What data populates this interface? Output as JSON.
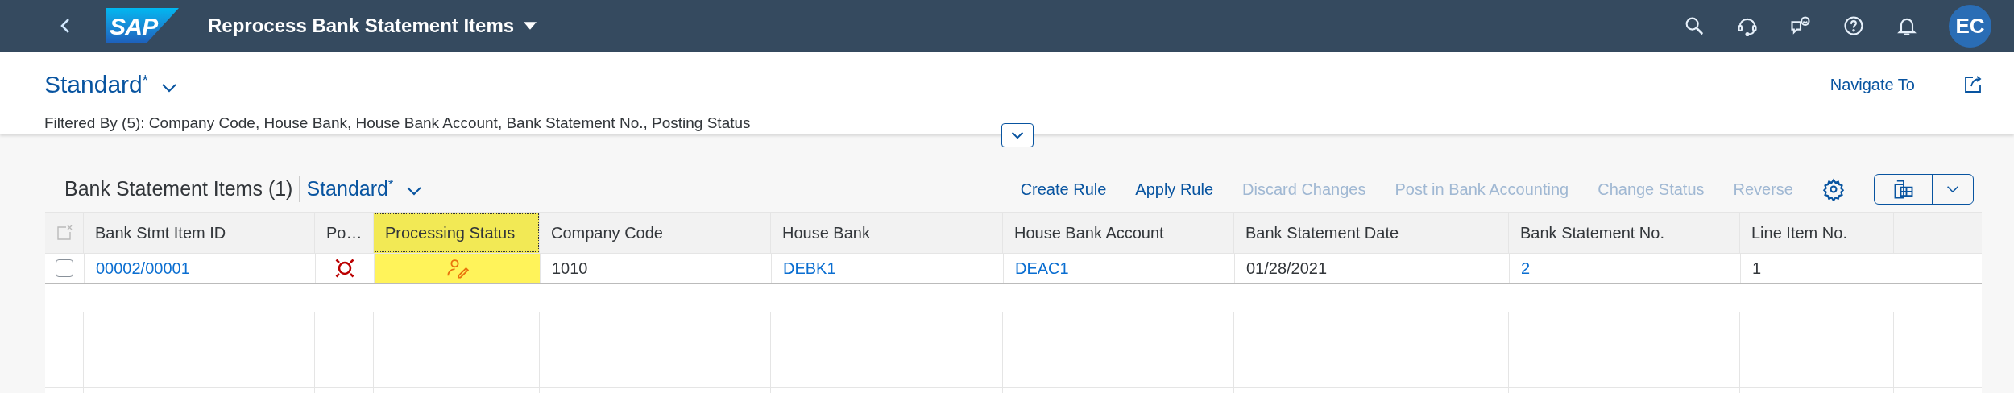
{
  "shell": {
    "logo": "SAP",
    "title": "Reprocess Bank Statement Items",
    "avatar": "EC"
  },
  "header": {
    "variant": "Standard",
    "modified_mark": "*",
    "filter_summary": "Filtered By (5): Company Code, House Bank, House Bank Account, Bank Statement No., Posting Status",
    "navigate": "Navigate To"
  },
  "table": {
    "title": "Bank Statement Items (1)",
    "variant": "Standard",
    "modified_mark": "*",
    "actions": [
      {
        "label": "Create Rule",
        "disabled": false
      },
      {
        "label": "Apply Rule",
        "disabled": false
      },
      {
        "label": "Discard Changes",
        "disabled": true
      },
      {
        "label": "Post in Bank Accounting",
        "disabled": true
      },
      {
        "label": "Change Status",
        "disabled": true
      },
      {
        "label": "Reverse",
        "disabled": true
      }
    ],
    "columns": [
      {
        "label": "Bank Stmt Item ID",
        "highlighted": false
      },
      {
        "label": "Po…",
        "highlighted": false
      },
      {
        "label": "Processing Status",
        "highlighted": true
      },
      {
        "label": "Company Code",
        "highlighted": false
      },
      {
        "label": "House Bank",
        "highlighted": false
      },
      {
        "label": "House Bank Account",
        "highlighted": false
      },
      {
        "label": "Bank Statement Date",
        "highlighted": false
      },
      {
        "label": "Bank Statement No.",
        "highlighted": false
      },
      {
        "label": "Line Item No.",
        "highlighted": false
      }
    ],
    "rows": [
      {
        "selected": false,
        "cells": [
          {
            "kind": "link",
            "text": "00002/00001"
          },
          {
            "kind": "error-icon"
          },
          {
            "kind": "edit-user-icon"
          },
          {
            "kind": "text",
            "text": "1010"
          },
          {
            "kind": "link",
            "text": "DEBK1"
          },
          {
            "kind": "link",
            "text": "DEAC1"
          },
          {
            "kind": "text",
            "text": "01/28/2021"
          },
          {
            "kind": "link",
            "text": "2"
          },
          {
            "kind": "text",
            "text": "1"
          }
        ]
      }
    ]
  }
}
